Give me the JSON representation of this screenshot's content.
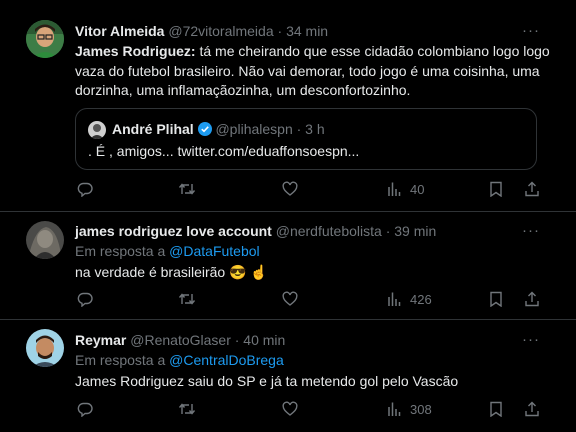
{
  "tweets": [
    {
      "name": "Vitor Almeida",
      "handle": "@72vitoralmeida",
      "time": "· 34 min",
      "more": "···",
      "text_bold": "James Rodriguez:",
      "text_rest": " tá me cheirando que esse cidadão colombiano logo logo vaza do futebol brasileiro. Não vai demorar, todo jogo é uma coisinha, uma dorzinha, uma inflamaçãozinha, um desconfortozinho.",
      "quote": {
        "name": "André Plihal",
        "handle": "@plihalespn",
        "time": "· 3 h",
        "text": ". É , amigos... twitter.com/eduaffonsoespn..."
      },
      "views": "40"
    },
    {
      "name": "james rodriguez love account",
      "handle": "@nerdfutebolista",
      "time": "· 39 min",
      "more": "···",
      "reply_prefix": "Em resposta a ",
      "reply_to": "@DataFutebol",
      "text": "na verdade é brasileirão 😎 ☝",
      "views": "426"
    },
    {
      "name": "Reymar",
      "handle": "@RenatoGlaser",
      "time": "· 40 min",
      "more": "···",
      "reply_prefix": "Em resposta a ",
      "reply_to": "@CentralDoBrega",
      "text": "James Rodriguez saiu do SP e já ta metendo gol pelo Vascão",
      "views": "308"
    }
  ],
  "icons": [
    "reply-icon",
    "retweet-icon",
    "like-icon",
    "views-icon",
    "bookmark-icon",
    "share-icon",
    "verified-icon",
    "more-icon"
  ],
  "colors": {
    "background": "#000000",
    "text": "#e7e9ea",
    "secondary": "#71767b",
    "link": "#1d9bf0",
    "divider": "#2f3336"
  }
}
